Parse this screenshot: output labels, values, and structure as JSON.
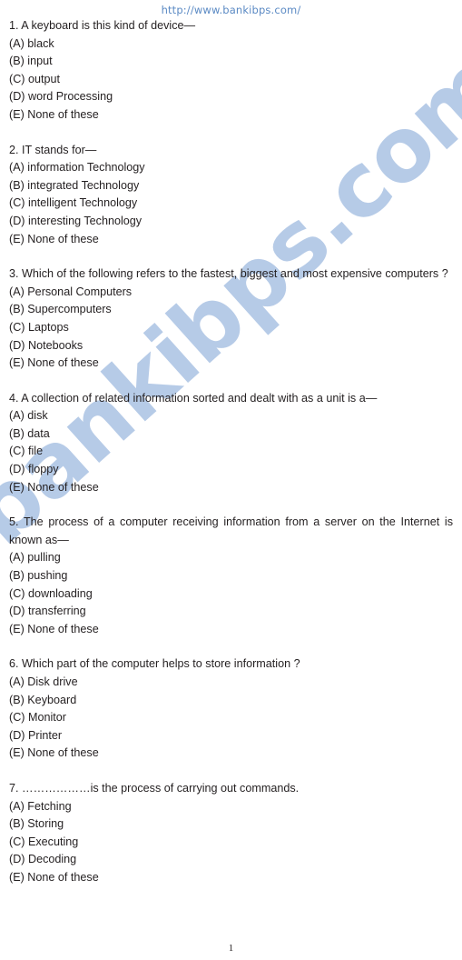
{
  "header": {
    "url": "http://www.bankibps.com/",
    "url_color": "#5b8ac4"
  },
  "watermark": {
    "text": "bankibps.com",
    "color": "#adc4e4"
  },
  "footer": {
    "page_number": "1"
  },
  "questions": [
    {
      "stem": "1. A keyboard is this kind of device—",
      "justified": false,
      "options": [
        "(A) black",
        "(B) input",
        "(C) output",
        "(D) word Processing",
        "(E) None of these"
      ]
    },
    {
      "stem": "2. IT stands for—",
      "justified": false,
      "options": [
        "(A) information Technology",
        "(B) integrated Technology",
        "(C) intelligent Technology",
        "(D) interesting Technology",
        "(E) None of these"
      ]
    },
    {
      "stem": "3. Which of the following refers to the fastest, biggest and most expensive computers ?",
      "justified": true,
      "options": [
        "(A) Personal Computers",
        "(B) Supercomputers",
        "(C) Laptops",
        "(D) Notebooks",
        "(E) None of these"
      ]
    },
    {
      "stem": "4. A collection of related information sorted and dealt with as a unit is a—",
      "justified": false,
      "options": [
        "(A) disk",
        "(B) data",
        "(C) file",
        "(D) floppy",
        "(E) None of these"
      ]
    },
    {
      "stem": "5. The process of a computer receiving information from a server on the Internet is known as—",
      "justified": true,
      "options": [
        "(A) pulling",
        "(B) pushing",
        "(C) downloading",
        "(D) transferring",
        "(E) None of these"
      ]
    },
    {
      "stem": "6. Which part of the computer helps to store information ?",
      "justified": false,
      "options": [
        "(A) Disk drive",
        "(B) Keyboard",
        "(C) Monitor",
        "(D) Printer",
        "(E) None of these"
      ]
    },
    {
      "stem": "7. ………………is the process of carrying out commands.",
      "justified": false,
      "options": [
        "(A) Fetching",
        "(B) Storing",
        "(C) Executing",
        "(D) Decoding",
        "(E) None of these"
      ]
    }
  ]
}
